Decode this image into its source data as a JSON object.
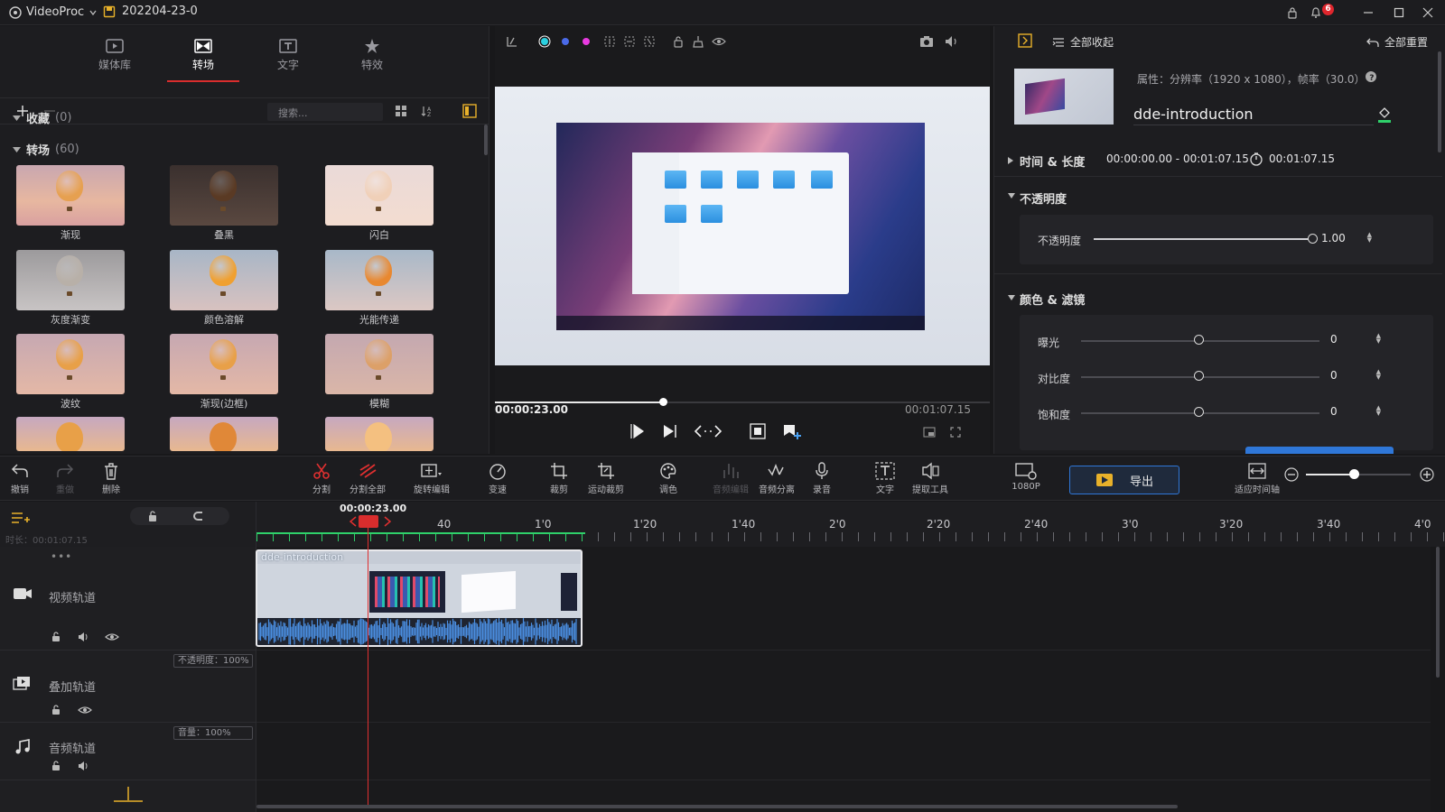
{
  "app": {
    "name": "VideoProc",
    "project": "202204-23-0",
    "notification_count": "6"
  },
  "left_tabs": [
    {
      "label": "媒体库",
      "icon": "media-library-icon"
    },
    {
      "label": "转场",
      "icon": "transition-icon"
    },
    {
      "label": "文字",
      "icon": "text-icon"
    },
    {
      "label": "特效",
      "icon": "effects-icon"
    }
  ],
  "search": {
    "placeholder": "搜索..."
  },
  "sections": {
    "favorites": {
      "label": "收藏",
      "count": "(0)"
    },
    "transitions": {
      "label": "转场",
      "count": "(60)"
    }
  },
  "transitions": [
    {
      "label": "渐现"
    },
    {
      "label": "叠黑"
    },
    {
      "label": "闪白"
    },
    {
      "label": "灰度渐变"
    },
    {
      "label": "颜色溶解"
    },
    {
      "label": "光能传递"
    },
    {
      "label": "波纹"
    },
    {
      "label": "渐现(边框)"
    },
    {
      "label": "模糊"
    }
  ],
  "preview": {
    "current_time": "00:00:23.00",
    "total_time": "00:01:07.15",
    "progress": 0.34
  },
  "right": {
    "collapse_all": "全部收起",
    "reset_all": "全部重置",
    "properties": "属性：分辨率（1920 x 1080），帧率（30.0）",
    "clip_name": "dde-introduction",
    "time_length_label": "时间 & 长度",
    "time_range": "00:00:00.00 - 00:01:07.15",
    "duration": "00:01:07.15",
    "opacity_section": "不透明度",
    "opacity_label": "不透明度",
    "opacity_value": "1.00",
    "color_section": "颜色 & 滤镜",
    "exposure_label": "曝光",
    "exposure_value": "0",
    "contrast_label": "对比度",
    "contrast_value": "0",
    "saturation_label": "饱和度",
    "saturation_value": "0"
  },
  "toolbar": {
    "undo": "撤销",
    "redo": "重做",
    "delete": "删除",
    "split": "分割",
    "split_all": "分割全部",
    "rotate_edit": "旋转编辑",
    "speed": "变速",
    "crop": "裁剪",
    "motion_crop": "运动裁剪",
    "color": "调色",
    "audio_edit": "音频编辑",
    "audio_separate": "音频分离",
    "record": "录音",
    "text": "文字",
    "extract": "提取工具",
    "resolution": "1080P",
    "export": "导出",
    "fit_timeline": "适应时间轴"
  },
  "timeline": {
    "playhead_time": "00:00:23.00",
    "duration_label": "时长：00:01:07.15",
    "ruler": [
      "40",
      "1'0",
      "1'20",
      "1'40",
      "2'0",
      "2'20",
      "2'40",
      "3'0",
      "3'20",
      "3'40",
      "4'0"
    ],
    "tracks": {
      "video": "视频轨道",
      "overlay": "叠加轨道",
      "overlay_opacity": "不透明度：100%",
      "audio": "音频轨道",
      "audio_volume": "音量：100%"
    },
    "clip_name": "dde-introduction"
  },
  "colors": {
    "accent": "#d92d2d",
    "export_border": "#2f77d8",
    "waveform": "#4a8ee0"
  }
}
